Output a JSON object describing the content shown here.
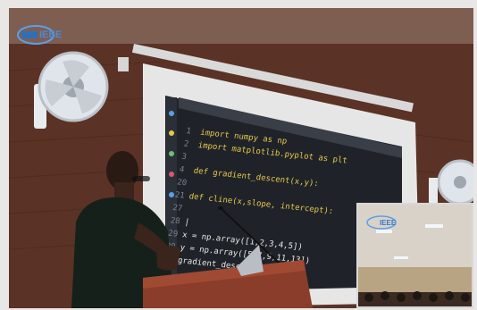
{
  "logo": {
    "text": "IEEE"
  },
  "inset_logo": {
    "text": "IEEE"
  },
  "slide": {
    "code_lines": [
      {
        "num": "1",
        "text": "import numpy as np"
      },
      {
        "num": "2",
        "text": "import matplotlib.pyplot as plt"
      },
      {
        "num": "3",
        "text": ""
      },
      {
        "num": "4",
        "text": "def gradient_descent(x,y):"
      },
      {
        "num": "20",
        "text": ""
      },
      {
        "num": "21",
        "text": "def cline(x,slope, intercept):"
      },
      {
        "num": "27",
        "text": ""
      },
      {
        "num": "28",
        "text": "  |"
      },
      {
        "num": "29",
        "text": "x = np.array([1,2,3,4,5])"
      },
      {
        "num": "30",
        "text": "y = np.array([5,7,9,11,13])"
      },
      {
        "num": "31",
        "text": "gradient_descent(x,y)"
      }
    ]
  },
  "colors": {
    "wall": "#6b3a2b",
    "screen": "#1f2329",
    "keyword": "#d65a6c",
    "function": "#e6c84a",
    "text": "#e8e8e8"
  }
}
